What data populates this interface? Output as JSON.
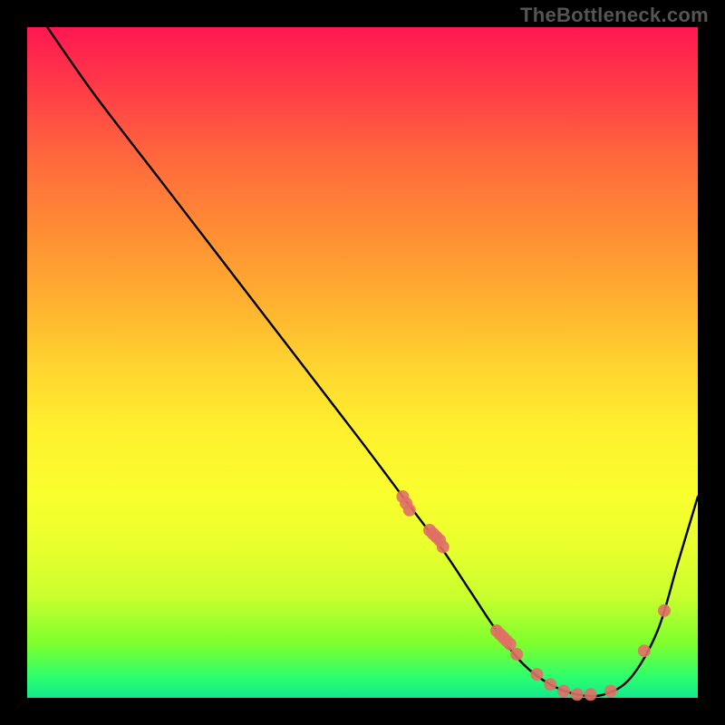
{
  "watermark": "TheBottleneck.com",
  "chart_data": {
    "type": "line",
    "title": "",
    "xlabel": "",
    "ylabel": "",
    "xlim": [
      0,
      100
    ],
    "ylim": [
      0,
      100
    ],
    "grid": false,
    "legend": false,
    "series": [
      {
        "name": "curve",
        "color": "#000000",
        "x": [
          3,
          10,
          20,
          30,
          40,
          50,
          56,
          62,
          66,
          70,
          74,
          78,
          82,
          86,
          90,
          94,
          97,
          100
        ],
        "y": [
          100,
          90,
          77,
          64,
          51,
          38,
          30,
          22,
          16,
          10,
          5,
          2,
          0.5,
          0.5,
          3,
          10,
          20,
          30
        ]
      }
    ],
    "points": {
      "name": "markers",
      "color": "#e07066",
      "x": [
        56,
        56.5,
        57,
        60,
        60.5,
        61,
        61.5,
        62,
        70,
        70.5,
        71,
        71.5,
        72,
        73,
        76,
        78,
        80,
        82,
        84,
        87,
        92,
        95
      ],
      "y": [
        30,
        29,
        28,
        25,
        24.5,
        24,
        23.5,
        22.5,
        10,
        9.5,
        9,
        8.5,
        8,
        6.5,
        3.5,
        2,
        1,
        0.5,
        0.5,
        1,
        7,
        13
      ]
    }
  }
}
